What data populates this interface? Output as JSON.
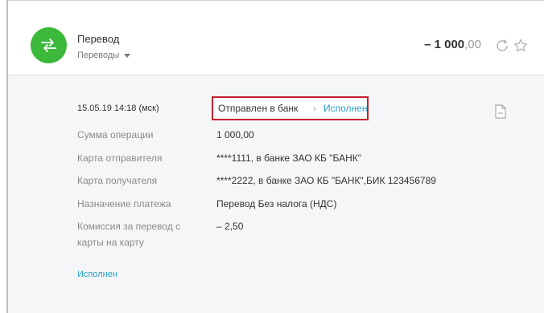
{
  "operation": {
    "title": "Перевод",
    "category": "Переводы",
    "amount_main": "– 1 000",
    "amount_cents": ",00",
    "accent_color": "#3cb83b"
  },
  "details": {
    "datetime": "15.05.19 14:18 (мск)",
    "status_sent": "Отправлен в банк",
    "status_separator": "›",
    "status_done": "Исполнен",
    "rows": [
      {
        "label": "Сумма операции",
        "value": "1 000,00"
      },
      {
        "label": "Карта отправителя",
        "value": "****1111, в банке ЗАО КБ \"БАНК\""
      },
      {
        "label": "Карта получателя",
        "value": "****2222, в банке ЗАО КБ \"БАНК\",БИК 123456789"
      },
      {
        "label": "Назначение платежа",
        "value": "Перевод Без налога (НДС)"
      },
      {
        "label_line1": "Комиссия за перевод с",
        "label_line2": "карты на карту",
        "value": "– 2,50"
      }
    ]
  },
  "footer": {
    "status_link": "Исполнен"
  },
  "icons": {
    "operation": "transfer-arrows-icon",
    "repeat": "repeat-icon",
    "favorite": "star-icon",
    "document": "document-icon"
  },
  "colors": {
    "highlight_border": "#c5202e",
    "link": "#2a9fc9"
  }
}
